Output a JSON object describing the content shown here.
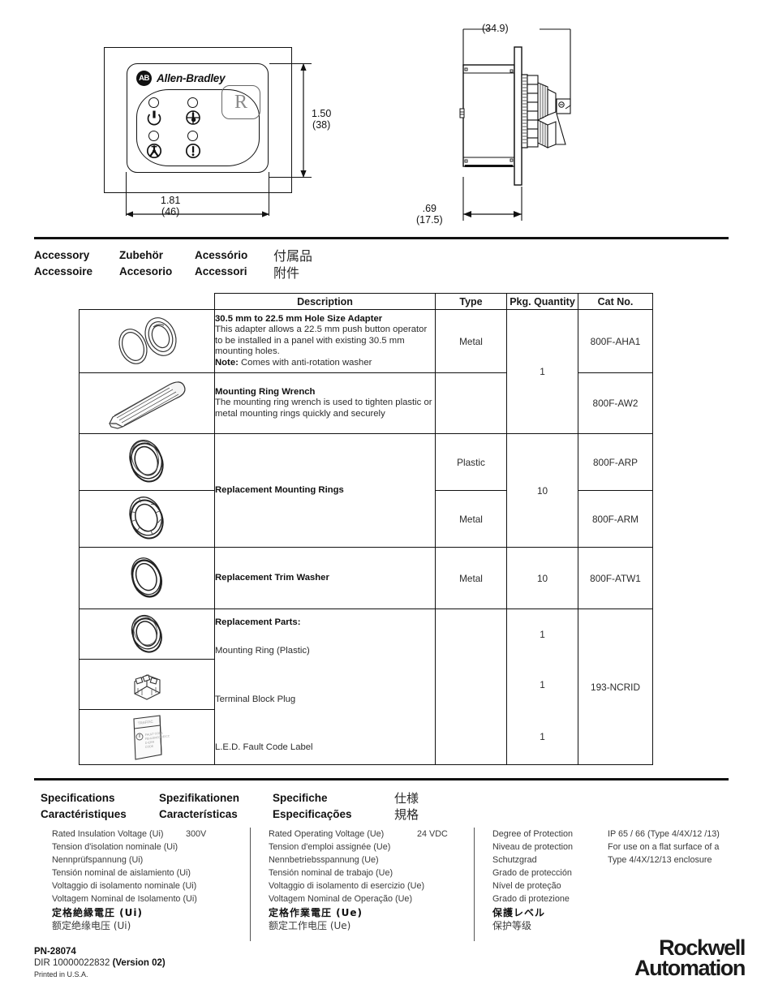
{
  "drawings": {
    "front_view": {
      "brand_badge": "AB",
      "brand_name": "Allen-Bradley",
      "reset_key_label": "R",
      "height_dim": {
        "inches": "1.50",
        "mm": "(38)"
      },
      "width_dim": {
        "inches": "1.81",
        "mm": "(46)"
      }
    },
    "side_view": {
      "depth_dim_mm": "(34.9)",
      "flange_dim": {
        "inches": ".69",
        "mm": "(17.5)"
      }
    }
  },
  "accessory_heading": {
    "col1": [
      "Accessory",
      "Accessoire"
    ],
    "col2": [
      "Zubehör",
      "Accesorio"
    ],
    "col3": [
      "Acessório",
      "Accessori"
    ],
    "col4": [
      "付属品",
      "附件"
    ]
  },
  "accessory_table": {
    "columns": [
      "",
      "Description",
      "Type",
      "Pkg. Quantity",
      "Cat No."
    ],
    "rows": [
      {
        "icon": "hole-size-adapter-icon",
        "title": "30.5 mm to 22.5 mm Hole Size Adapter",
        "body": "This adapter allows a 22.5 mm push button operator to be installed in a panel with existing 30.5 mm mounting holes.",
        "note_label": "Note:",
        "note_text": " Comes with anti-rotation washer",
        "type": "Metal",
        "qty": "1",
        "cat": "800F-AHA1"
      },
      {
        "icon": "mounting-ring-wrench-icon",
        "title": "Mounting Ring Wrench",
        "body": "The mounting ring wrench is used to tighten plastic or metal mounting rings quickly and securely",
        "type": "",
        "qty": "",
        "cat": "800F-AW2"
      },
      {
        "icon": "plastic-mounting-ring-icon",
        "title": "Replacement Mounting Rings",
        "type": "Plastic",
        "qty": "10",
        "cat": "800F-ARP"
      },
      {
        "icon": "metal-mounting-ring-icon",
        "title": "",
        "type": "Metal",
        "qty": "",
        "cat": "800F-ARM"
      },
      {
        "icon": "trim-washer-icon",
        "title": "Replacement Trim Washer",
        "type": "Metal",
        "qty": "10",
        "cat": "800F-ATW1"
      }
    ],
    "replacement_parts": {
      "heading": "Replacement Parts:",
      "cat": "193-NCRID",
      "items": [
        {
          "icon": "mounting-ring-plastic-icon",
          "label": "Mounting Ring (Plastic)",
          "qty": "1"
        },
        {
          "icon": "terminal-block-plug-icon",
          "label": "Terminal Block Plug",
          "qty": "1"
        },
        {
          "icon": "led-fault-code-label-icon",
          "label": "L.E.D. Fault Code Label",
          "qty": "1"
        }
      ]
    }
  },
  "spec_heading": {
    "col1": [
      "Specifications",
      "Caractéristiques"
    ],
    "col2": [
      "Spezifikationen",
      "Características"
    ],
    "col3": [
      "Specifiche",
      "Especificações"
    ],
    "col4": [
      "仕様",
      "規格"
    ]
  },
  "specifications": {
    "column1": {
      "value": "300V",
      "lines": [
        "Rated Insulation Voltage (Ui)",
        "Tension d'isolation nominale (Ui)",
        "Nennprüfspannung (Ui)",
        "Tensión nominal de aislamiento (Ui)",
        "Voltaggio di isolamento nominale (Ui)",
        "Voltagem Nominal de Isolamento (Ui)",
        "定格絶縁電圧 (Ui)",
        "额定绝缘电压 (Ui)"
      ]
    },
    "column2": {
      "value": "24 VDC",
      "lines": [
        "Rated Operating Voltage (Ue)",
        "Tension d'emploi assignée (Ue)",
        "Nennbetriebsspannung (Ue)",
        "Tensión nominal de trabajo (Ue)",
        "Voltaggio di isolamento di esercizio (Ue)",
        "Voltagem Nominal de Operação (Ue)",
        "定格作業電圧 (Ue)",
        "额定工作电压 (Ue)"
      ]
    },
    "column3": {
      "values": [
        "IP 65 / 66 (Type 4/4X/12 /13)",
        "For use on a flat surface of a",
        "Type 4/4X/12/13 enclosure"
      ],
      "lines": [
        "Degree of Protection",
        "Niveau de protection",
        "Schutzgrad",
        "Grado de protección",
        "Nível de proteção",
        "Grado di protezione",
        "保護レベル",
        "保护等级"
      ]
    }
  },
  "footer": {
    "pn": "PN-28074",
    "dir_prefix": "DIR 10000022832 ",
    "dir_version": "(Version 02)",
    "printed": "Printed in U.S.A.",
    "logo_line1": "Rockwell",
    "logo_line2": "Automation"
  }
}
